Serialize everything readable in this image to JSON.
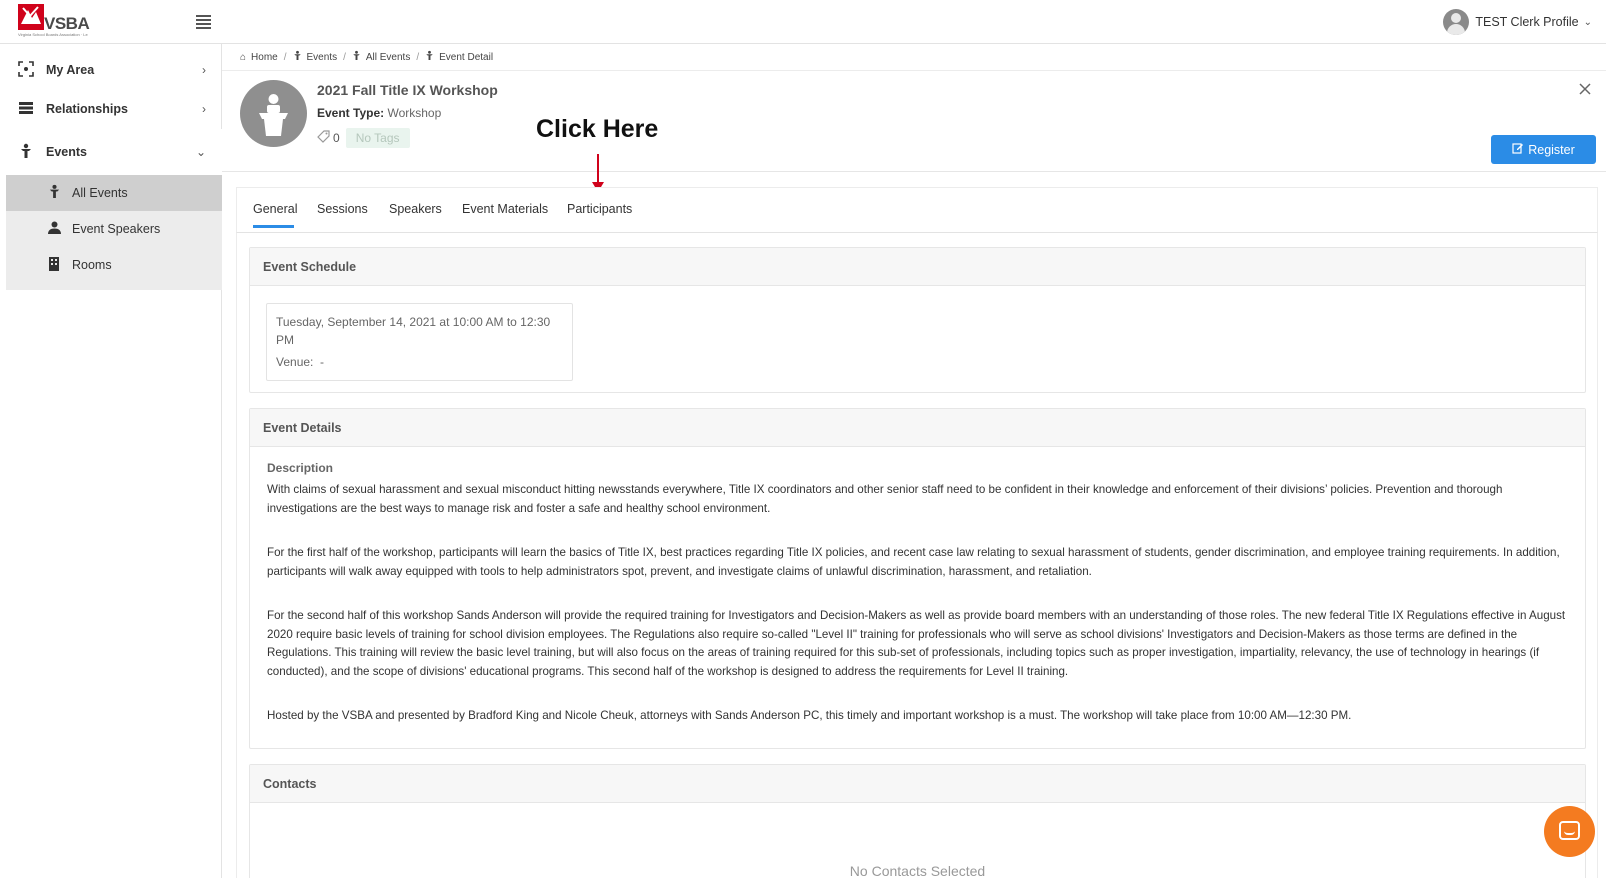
{
  "app": {
    "logo_text": "VSBA",
    "logo_subtitle": "Virginia School Boards Association · Leadership · Advocacy · Support"
  },
  "topbar": {
    "profile_name": "TEST Clerk Profile"
  },
  "sidebar": {
    "items": [
      {
        "label": "My Area",
        "icon": "focus-icon"
      },
      {
        "label": "Relationships",
        "icon": "server-icon"
      },
      {
        "label": "Events",
        "icon": "podium-icon"
      }
    ],
    "sub_items": [
      {
        "label": "All Events",
        "icon": "podium-icon"
      },
      {
        "label": "Event Speakers",
        "icon": "speaker-icon"
      },
      {
        "label": "Rooms",
        "icon": "building-icon"
      }
    ]
  },
  "breadcrumb": [
    "Home",
    "Events",
    "All Events",
    "Event Detail"
  ],
  "event": {
    "title": "2021 Fall Title IX Workshop",
    "type_label": "Event Type:",
    "type_value": "Workshop",
    "tag_count": "0",
    "no_tags": "No Tags",
    "register_label": "Register"
  },
  "annotation": {
    "text": "Click Here",
    "arrow_color": "#d0021b"
  },
  "tabs": [
    "General",
    "Sessions",
    "Speakers",
    "Event Materials",
    "Participants"
  ],
  "active_tab": "General",
  "schedule": {
    "heading": "Event Schedule",
    "datetime": "Tuesday, September 14, 2021 at 10:00 AM to 12:30 PM",
    "venue_label": "Venue:",
    "venue_value": "-"
  },
  "details": {
    "heading": "Event Details",
    "description_label": "Description",
    "paragraphs": [
      "With claims of sexual harassment and sexual misconduct hitting newsstands everywhere, Title IX coordinators and other senior staff need to be confident in their knowledge and enforcement of their divisions’ policies. Prevention and thorough investigations are the best ways to manage risk and foster a safe and healthy school environment.",
      "For the first half of the workshop, participants will learn the basics of Title IX, best practices regarding Title IX policies, and recent case law relating to sexual harassment of students, gender discrimination, and employee training requirements. In addition, participants will walk away equipped with tools to help administrators spot, prevent, and investigate claims of unlawful discrimination, harassment, and retaliation.",
      "For the second half of this workshop Sands Anderson will provide the required training for Investigators and Decision-Makers as well as provide board members with an understanding of those roles. The new federal Title IX Regulations effective in August 2020 require basic levels of training for school division employees. The Regulations also require so-called \"Level II\" training for professionals who will serve as school divisions' Investigators and Decision-Makers as those terms are defined in the Regulations. This training will review the basic level training, but will also focus on the areas of training required for this sub-set of professionals, including topics such as proper investigation, impartiality, relevancy, the use of technology in hearings (if conducted), and the scope of divisions' educational programs. This second half of the workshop is designed to address the requirements for Level II training.",
      "Hosted by the VSBA and presented by Bradford King and Nicole Cheuk, attorneys with Sands Anderson PC, this timely and important workshop is a must. The workshop will take place from 10:00 AM—12:30 PM."
    ]
  },
  "contacts": {
    "heading": "Contacts",
    "empty_text": "No Contacts Selected"
  },
  "colors": {
    "accent": "#2b8ce6",
    "chat": "#f47b20"
  }
}
